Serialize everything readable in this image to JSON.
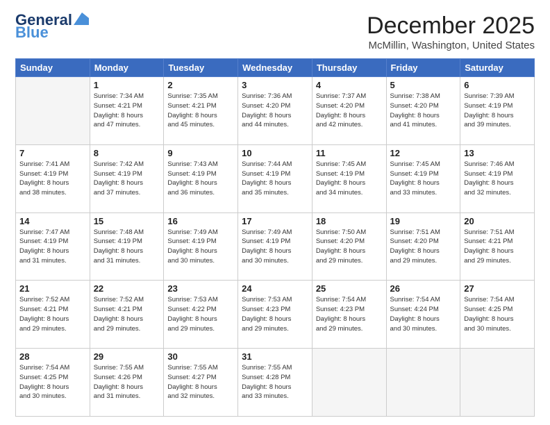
{
  "header": {
    "logo_line1": "General",
    "logo_line2": "Blue",
    "cal_title": "December 2025",
    "cal_subtitle": "McMillin, Washington, United States"
  },
  "days_of_week": [
    "Sunday",
    "Monday",
    "Tuesday",
    "Wednesday",
    "Thursday",
    "Friday",
    "Saturday"
  ],
  "weeks": [
    [
      {
        "day": "",
        "info": ""
      },
      {
        "day": "1",
        "info": "Sunrise: 7:34 AM\nSunset: 4:21 PM\nDaylight: 8 hours\nand 47 minutes."
      },
      {
        "day": "2",
        "info": "Sunrise: 7:35 AM\nSunset: 4:21 PM\nDaylight: 8 hours\nand 45 minutes."
      },
      {
        "day": "3",
        "info": "Sunrise: 7:36 AM\nSunset: 4:20 PM\nDaylight: 8 hours\nand 44 minutes."
      },
      {
        "day": "4",
        "info": "Sunrise: 7:37 AM\nSunset: 4:20 PM\nDaylight: 8 hours\nand 42 minutes."
      },
      {
        "day": "5",
        "info": "Sunrise: 7:38 AM\nSunset: 4:20 PM\nDaylight: 8 hours\nand 41 minutes."
      },
      {
        "day": "6",
        "info": "Sunrise: 7:39 AM\nSunset: 4:19 PM\nDaylight: 8 hours\nand 39 minutes."
      }
    ],
    [
      {
        "day": "7",
        "info": "Sunrise: 7:41 AM\nSunset: 4:19 PM\nDaylight: 8 hours\nand 38 minutes."
      },
      {
        "day": "8",
        "info": "Sunrise: 7:42 AM\nSunset: 4:19 PM\nDaylight: 8 hours\nand 37 minutes."
      },
      {
        "day": "9",
        "info": "Sunrise: 7:43 AM\nSunset: 4:19 PM\nDaylight: 8 hours\nand 36 minutes."
      },
      {
        "day": "10",
        "info": "Sunrise: 7:44 AM\nSunset: 4:19 PM\nDaylight: 8 hours\nand 35 minutes."
      },
      {
        "day": "11",
        "info": "Sunrise: 7:45 AM\nSunset: 4:19 PM\nDaylight: 8 hours\nand 34 minutes."
      },
      {
        "day": "12",
        "info": "Sunrise: 7:45 AM\nSunset: 4:19 PM\nDaylight: 8 hours\nand 33 minutes."
      },
      {
        "day": "13",
        "info": "Sunrise: 7:46 AM\nSunset: 4:19 PM\nDaylight: 8 hours\nand 32 minutes."
      }
    ],
    [
      {
        "day": "14",
        "info": "Sunrise: 7:47 AM\nSunset: 4:19 PM\nDaylight: 8 hours\nand 31 minutes."
      },
      {
        "day": "15",
        "info": "Sunrise: 7:48 AM\nSunset: 4:19 PM\nDaylight: 8 hours\nand 31 minutes."
      },
      {
        "day": "16",
        "info": "Sunrise: 7:49 AM\nSunset: 4:19 PM\nDaylight: 8 hours\nand 30 minutes."
      },
      {
        "day": "17",
        "info": "Sunrise: 7:49 AM\nSunset: 4:19 PM\nDaylight: 8 hours\nand 30 minutes."
      },
      {
        "day": "18",
        "info": "Sunrise: 7:50 AM\nSunset: 4:20 PM\nDaylight: 8 hours\nand 29 minutes."
      },
      {
        "day": "19",
        "info": "Sunrise: 7:51 AM\nSunset: 4:20 PM\nDaylight: 8 hours\nand 29 minutes."
      },
      {
        "day": "20",
        "info": "Sunrise: 7:51 AM\nSunset: 4:21 PM\nDaylight: 8 hours\nand 29 minutes."
      }
    ],
    [
      {
        "day": "21",
        "info": "Sunrise: 7:52 AM\nSunset: 4:21 PM\nDaylight: 8 hours\nand 29 minutes."
      },
      {
        "day": "22",
        "info": "Sunrise: 7:52 AM\nSunset: 4:21 PM\nDaylight: 8 hours\nand 29 minutes."
      },
      {
        "day": "23",
        "info": "Sunrise: 7:53 AM\nSunset: 4:22 PM\nDaylight: 8 hours\nand 29 minutes."
      },
      {
        "day": "24",
        "info": "Sunrise: 7:53 AM\nSunset: 4:23 PM\nDaylight: 8 hours\nand 29 minutes."
      },
      {
        "day": "25",
        "info": "Sunrise: 7:54 AM\nSunset: 4:23 PM\nDaylight: 8 hours\nand 29 minutes."
      },
      {
        "day": "26",
        "info": "Sunrise: 7:54 AM\nSunset: 4:24 PM\nDaylight: 8 hours\nand 30 minutes."
      },
      {
        "day": "27",
        "info": "Sunrise: 7:54 AM\nSunset: 4:25 PM\nDaylight: 8 hours\nand 30 minutes."
      }
    ],
    [
      {
        "day": "28",
        "info": "Sunrise: 7:54 AM\nSunset: 4:25 PM\nDaylight: 8 hours\nand 30 minutes."
      },
      {
        "day": "29",
        "info": "Sunrise: 7:55 AM\nSunset: 4:26 PM\nDaylight: 8 hours\nand 31 minutes."
      },
      {
        "day": "30",
        "info": "Sunrise: 7:55 AM\nSunset: 4:27 PM\nDaylight: 8 hours\nand 32 minutes."
      },
      {
        "day": "31",
        "info": "Sunrise: 7:55 AM\nSunset: 4:28 PM\nDaylight: 8 hours\nand 33 minutes."
      },
      {
        "day": "",
        "info": ""
      },
      {
        "day": "",
        "info": ""
      },
      {
        "day": "",
        "info": ""
      }
    ]
  ]
}
